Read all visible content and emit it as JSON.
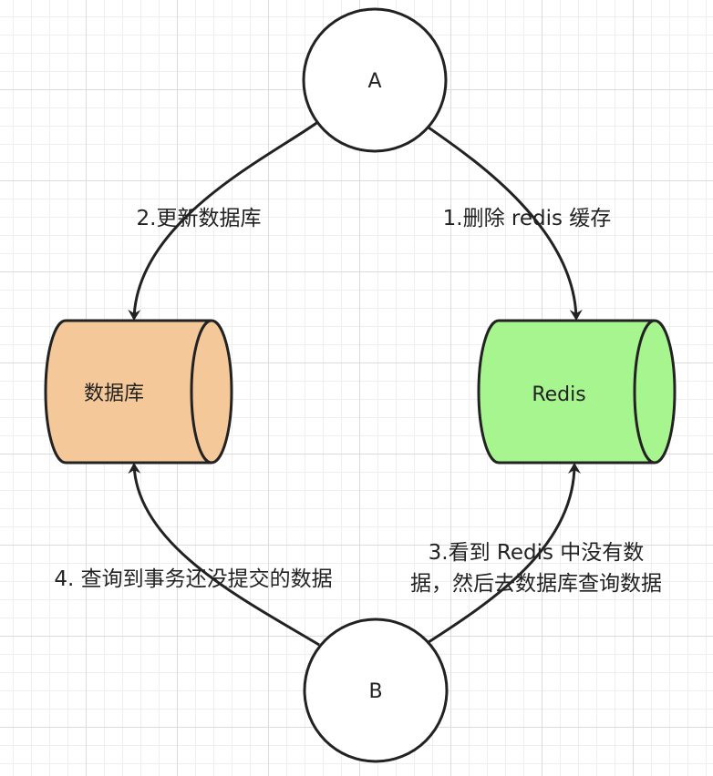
{
  "nodes": {
    "a": {
      "label": "A"
    },
    "b": {
      "label": "B"
    },
    "database": {
      "label": "数据库",
      "fill": "#f5c89a"
    },
    "redis": {
      "label": "Redis",
      "fill": "#a6f58f"
    }
  },
  "edges": {
    "step1": {
      "label": "1.删除 redis 缓存"
    },
    "step2": {
      "label": "2.更新数据库"
    },
    "step3": {
      "label_line1": "3.看到 Redis 中没有数",
      "label_line2": "据，然后去数据库查询数据"
    },
    "step4": {
      "label": "4. 查询到事务还没提交的数据"
    }
  },
  "colors": {
    "stroke": "#222222",
    "text": "#222222"
  }
}
